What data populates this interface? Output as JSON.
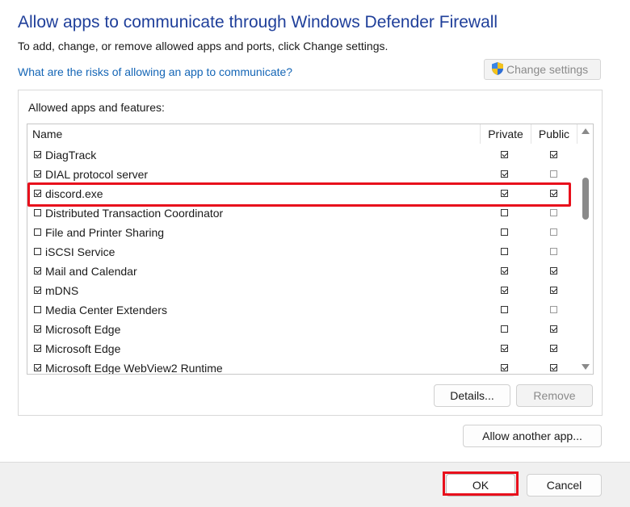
{
  "dialog": {
    "title": "Allow apps to communicate through Windows Defender Firewall",
    "subtitle": "To add, change, or remove allowed apps and ports, click Change settings.",
    "risk_link": "What are the risks of allowing an app to communicate?",
    "change_settings_label": "Change settings",
    "change_settings_icon": "uac-shield-icon"
  },
  "allowed": {
    "group_label": "Allowed apps and features:",
    "columns": {
      "name": "Name",
      "private": "Private",
      "public": "Public"
    },
    "rows": [
      {
        "name": "DiagTrack",
        "enabled": true,
        "private": true,
        "public": true
      },
      {
        "name": "DIAL protocol server",
        "enabled": true,
        "private": true,
        "public": false
      },
      {
        "name": "discord.exe",
        "enabled": true,
        "private": true,
        "public": true,
        "highlighted": true
      },
      {
        "name": "Distributed Transaction Coordinator",
        "enabled": false,
        "private": false,
        "public": false
      },
      {
        "name": "File and Printer Sharing",
        "enabled": false,
        "private": false,
        "public": false
      },
      {
        "name": "iSCSI Service",
        "enabled": false,
        "private": false,
        "public": false
      },
      {
        "name": "Mail and Calendar",
        "enabled": true,
        "private": true,
        "public": true
      },
      {
        "name": "mDNS",
        "enabled": true,
        "private": true,
        "public": true
      },
      {
        "name": "Media Center Extenders",
        "enabled": false,
        "private": false,
        "public": false
      },
      {
        "name": "Microsoft Edge",
        "enabled": true,
        "private": false,
        "public": true
      },
      {
        "name": "Microsoft Edge",
        "enabled": true,
        "private": true,
        "public": true
      },
      {
        "name": "Microsoft Edge WebView2 Runtime",
        "enabled": true,
        "private": true,
        "public": true
      }
    ],
    "details_label": "Details...",
    "remove_label": "Remove"
  },
  "allow_another_label": "Allow another app...",
  "footer": {
    "ok_label": "OK",
    "cancel_label": "Cancel"
  },
  "colors": {
    "title": "#1f3f9a",
    "link": "#1566b6",
    "highlight": "#e8101c"
  }
}
